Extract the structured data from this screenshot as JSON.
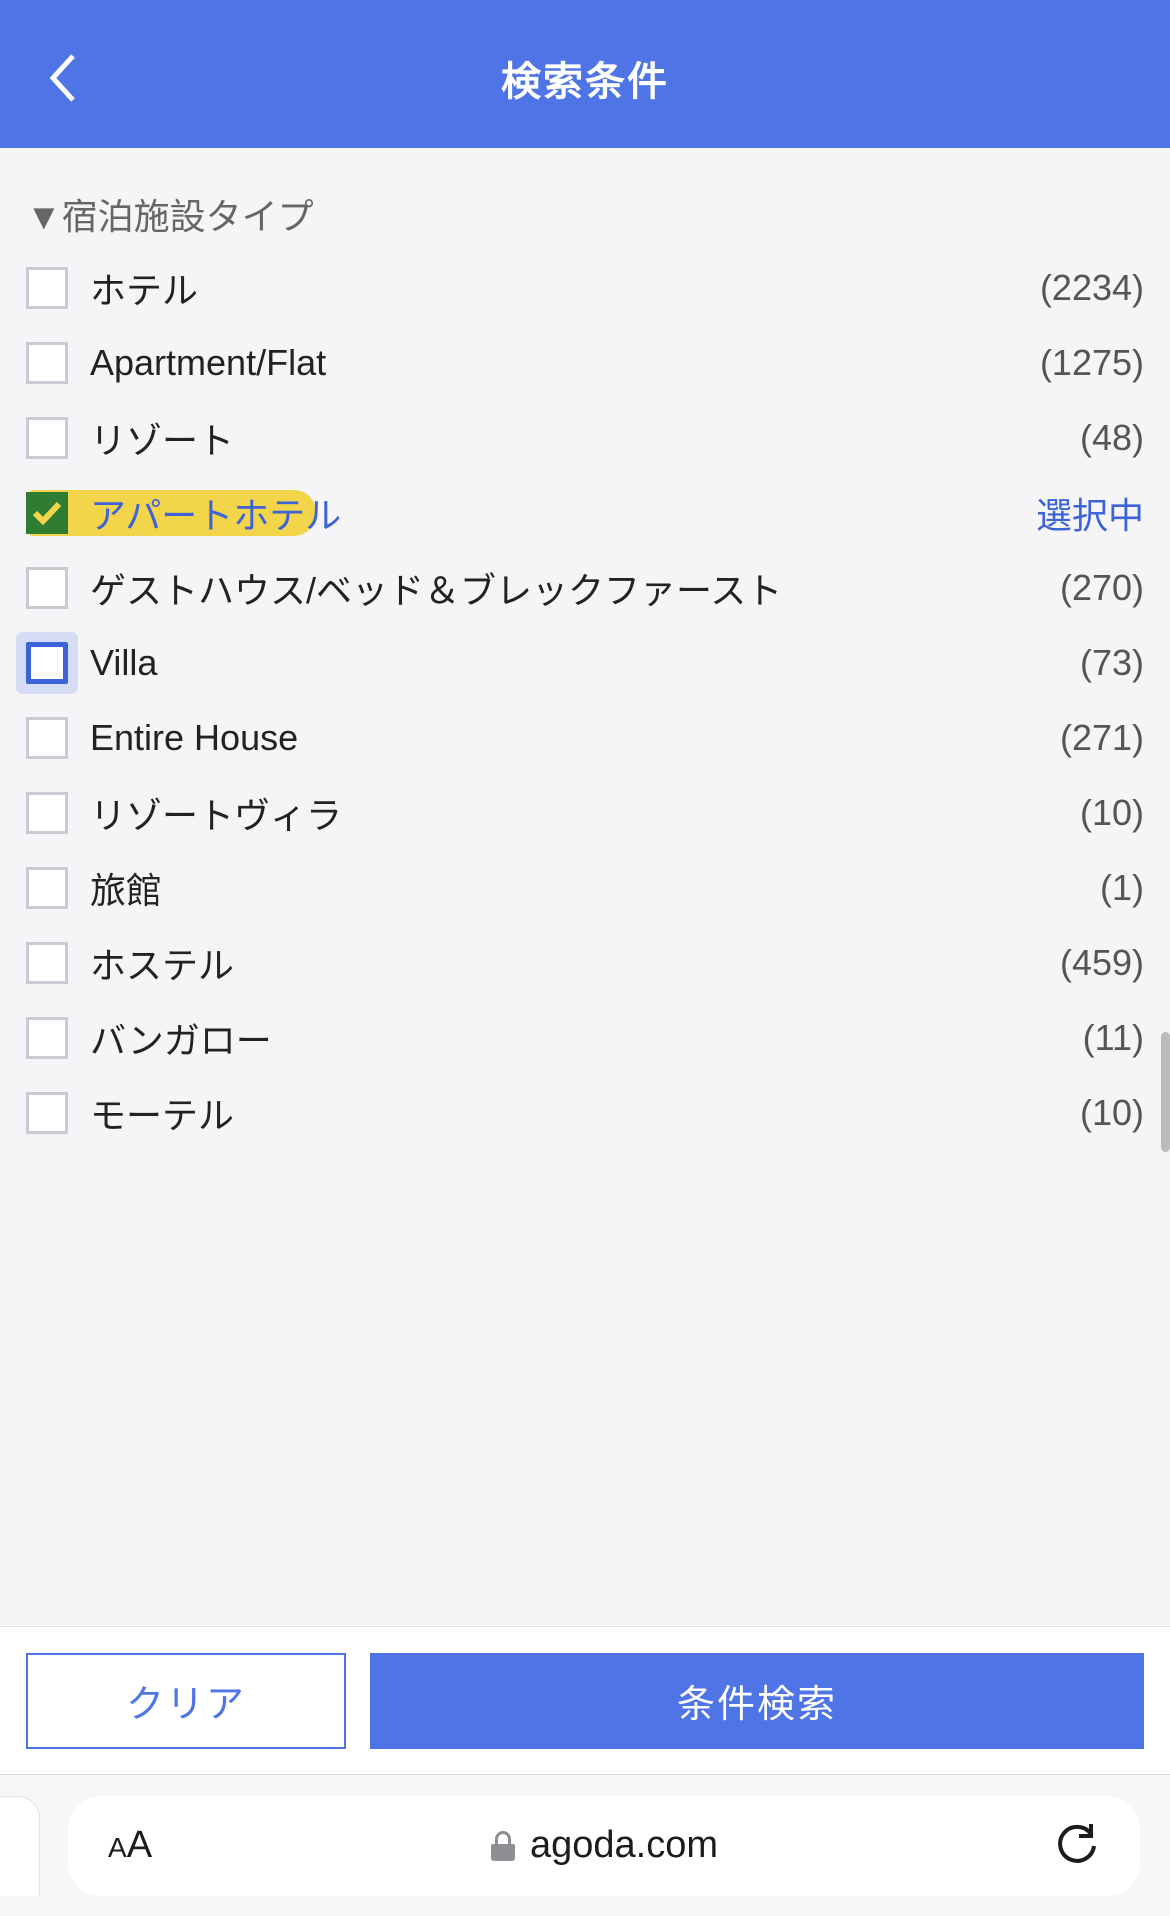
{
  "header": {
    "title": "検索条件"
  },
  "section": {
    "title": "▼宿泊施設タイプ"
  },
  "selected_badge": "選択中",
  "items": [
    {
      "label": "ホテル",
      "count": "(2234)",
      "checked": false,
      "selected": false,
      "highlight": false,
      "focused": false
    },
    {
      "label": "Apartment/Flat",
      "count": "(1275)",
      "checked": false,
      "selected": false,
      "highlight": false,
      "focused": false
    },
    {
      "label": "リゾート",
      "count": "(48)",
      "checked": false,
      "selected": false,
      "highlight": false,
      "focused": false
    },
    {
      "label": "アパートホテル",
      "count": "選択中",
      "checked": true,
      "selected": true,
      "highlight": true,
      "focused": false
    },
    {
      "label": "ゲストハウス/ベッド＆ブレックファースト",
      "count": "(270)",
      "checked": false,
      "selected": false,
      "highlight": false,
      "focused": false
    },
    {
      "label": "Villa",
      "count": "(73)",
      "checked": false,
      "selected": false,
      "highlight": false,
      "focused": true
    },
    {
      "label": "Entire House",
      "count": "(271)",
      "checked": false,
      "selected": false,
      "highlight": false,
      "focused": false
    },
    {
      "label": "リゾートヴィラ",
      "count": "(10)",
      "checked": false,
      "selected": false,
      "highlight": false,
      "focused": false
    },
    {
      "label": "旅館",
      "count": "(1)",
      "checked": false,
      "selected": false,
      "highlight": false,
      "focused": false
    },
    {
      "label": "ホステル",
      "count": "(459)",
      "checked": false,
      "selected": false,
      "highlight": false,
      "focused": false
    },
    {
      "label": "バンガロー",
      "count": "(11)",
      "checked": false,
      "selected": false,
      "highlight": false,
      "focused": false
    },
    {
      "label": "モーテル",
      "count": "(10)",
      "checked": false,
      "selected": false,
      "highlight": false,
      "focused": false
    }
  ],
  "actions": {
    "clear": "クリア",
    "search": "条件検索"
  },
  "browser": {
    "aa": "AA",
    "domain": "agoda.com"
  }
}
